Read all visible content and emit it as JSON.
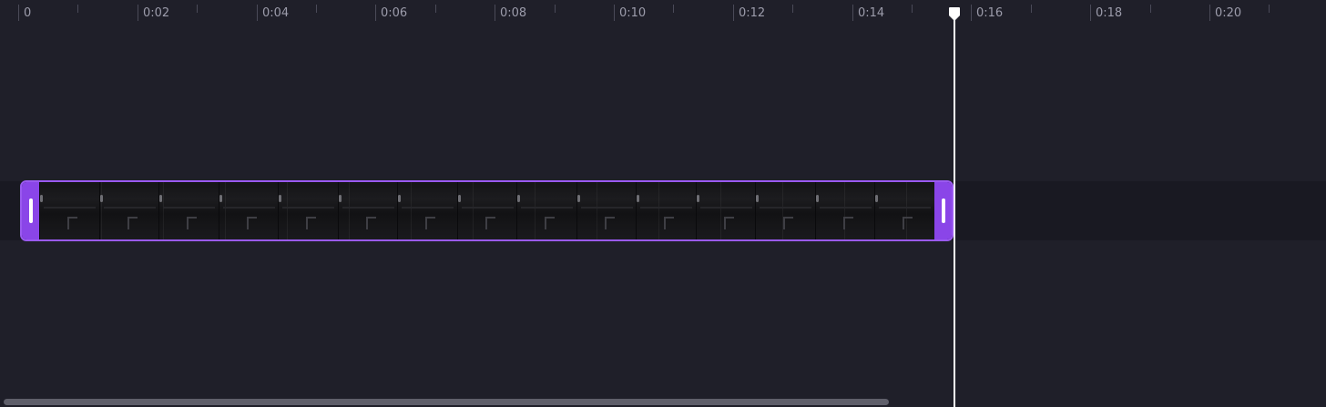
{
  "ruler": {
    "labels": [
      "0",
      "0:02",
      "0:04",
      "0:06",
      "0:08",
      "0:10",
      "0:12",
      "0:14",
      "0:16",
      "0:18",
      "0:20"
    ]
  },
  "clip": {
    "color": "#8a45e8",
    "frame_count": 15
  },
  "playhead": {
    "color": "#ffffff"
  },
  "colors": {
    "background": "#1f1f29",
    "accent": "#9a5af0"
  }
}
